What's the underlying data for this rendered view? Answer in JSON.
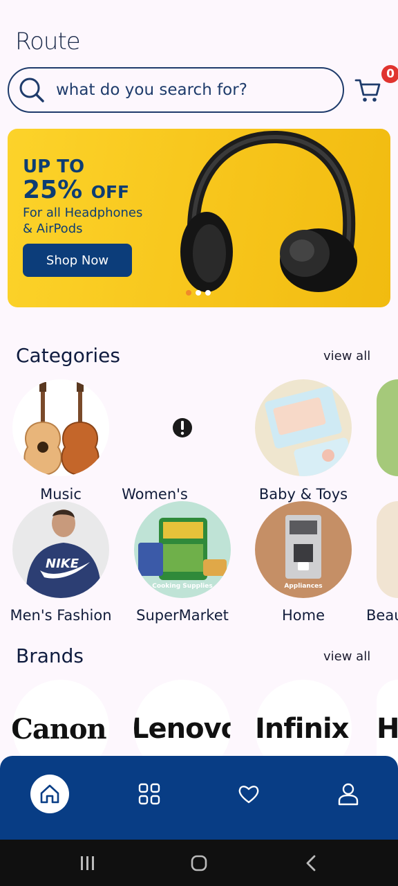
{
  "app": {
    "logo": "Route"
  },
  "search": {
    "placeholder": "what do you search for?"
  },
  "cart": {
    "count": "0"
  },
  "banner": {
    "line1": "UP TO",
    "line2_percent": "25%",
    "line2_off": "OFF",
    "line3": "For all Headphones",
    "line4": "& AirPods",
    "button": "Shop Now",
    "slides": 3,
    "active_slide": 0
  },
  "categories": {
    "title": "Categories",
    "view_all": "view all",
    "items": [
      {
        "label": "Music"
      },
      {
        "label": "Women's"
      },
      {
        "label": "Baby & Toys"
      },
      {
        "label": "Men's Fashion"
      },
      {
        "label": "SuperMarket",
        "image_caption": "Cooking Supplies"
      },
      {
        "label": "Home",
        "image_caption": "Appliances"
      },
      {
        "label": "Beau"
      }
    ]
  },
  "brands": {
    "title": "Brands",
    "view_all": "view all",
    "items": [
      "Canon",
      "Lenovo",
      "Infinix",
      "HO"
    ]
  },
  "nav": {
    "items": [
      {
        "icon": "home-icon",
        "active": true
      },
      {
        "icon": "grid-icon",
        "active": false
      },
      {
        "icon": "heart-icon",
        "active": false
      },
      {
        "icon": "profile-icon",
        "active": false
      }
    ]
  },
  "colors": {
    "accent": "#083d85",
    "banner_yellow": "#fcd32a",
    "badge_red": "#e0342f",
    "background": "#fdf7fd"
  }
}
